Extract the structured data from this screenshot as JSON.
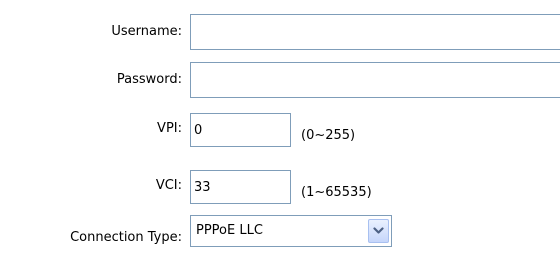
{
  "form": {
    "username": {
      "label": "Username:",
      "value": ""
    },
    "password": {
      "label": "Password:",
      "value": ""
    },
    "vpi": {
      "label": "VPI:",
      "value": "0",
      "range": "(0~255)"
    },
    "vci": {
      "label": "VCI:",
      "value": "33",
      "range": "(1~65535)"
    },
    "connection_type": {
      "label": "Connection Type:",
      "selected": "PPPoE LLC",
      "icon": "chevron-down-icon"
    }
  },
  "colors": {
    "field_border": "#7f9db9",
    "dropdown_arrow": "#4d6185"
  }
}
